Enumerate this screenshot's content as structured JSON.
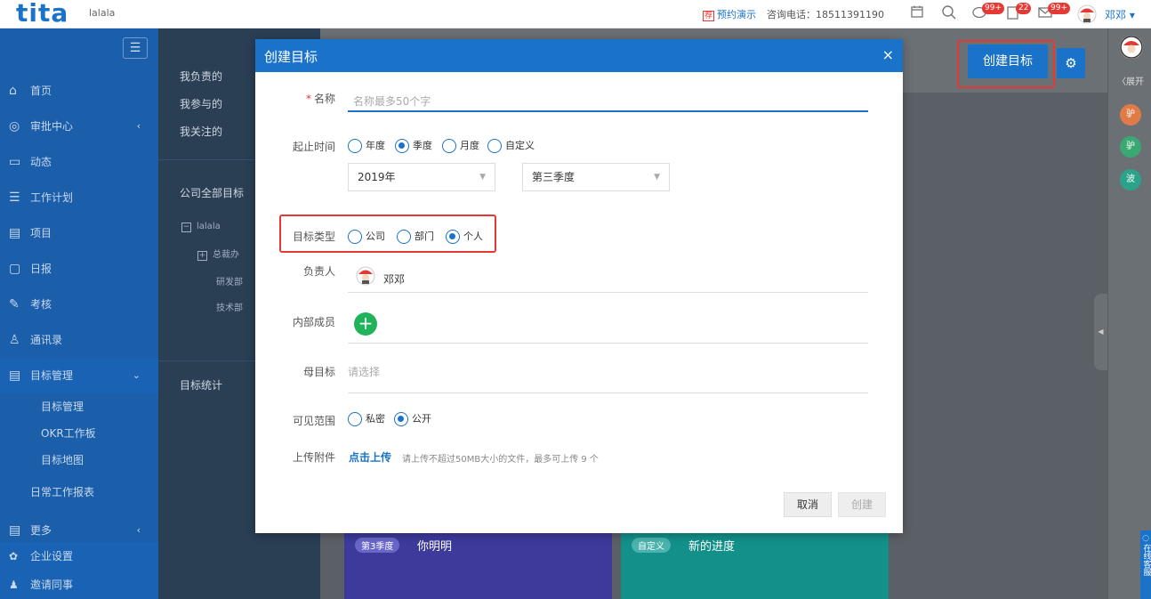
{
  "topbar": {
    "logo": "tita",
    "org": "lalala",
    "promo_tag": "荐",
    "promo_text": "预约演示",
    "phone": "咨询电话：18511391190",
    "badges": [
      "99+",
      "22",
      "99+"
    ],
    "user": "邓邓 ▾"
  },
  "sidebar": {
    "items": [
      {
        "icon": "⌂",
        "label": "首页"
      },
      {
        "icon": "◎",
        "label": "审批中心",
        "arrow": "‹"
      },
      {
        "icon": "▭",
        "label": "动态"
      },
      {
        "icon": "☰",
        "label": "工作计划"
      },
      {
        "icon": "▤",
        "label": "项目"
      },
      {
        "icon": "▢",
        "label": "日报"
      },
      {
        "icon": "✎",
        "label": "考核"
      },
      {
        "icon": "♙",
        "label": "通讯录"
      },
      {
        "icon": "▤",
        "label": "目标管理",
        "arrow": "⌄"
      }
    ],
    "sub_items": [
      "目标管理",
      "OKR工作板",
      "目标地图",
      "日常工作报表"
    ],
    "more": {
      "icon": "▤",
      "label": "更多",
      "arrow": "‹"
    },
    "bottom": [
      {
        "icon": "✿",
        "label": "企业设置"
      },
      {
        "icon": "♟",
        "label": "邀请同事"
      }
    ]
  },
  "panel2": {
    "items": [
      "我负责的",
      "我参与的",
      "我关注的"
    ],
    "section": "公司全部目标",
    "tree": [
      "lalala",
      "总裁办",
      "研发部",
      "技术部"
    ],
    "stats": "目标统计"
  },
  "main": {
    "create_btn": "创建目标",
    "cards": [
      {
        "tag": "第3季度",
        "title": "你明明"
      },
      {
        "tag": "自定义",
        "title": "新的进度"
      }
    ]
  },
  "rail": {
    "expand": "〈展开",
    "dots": [
      "驴",
      "驴",
      "波"
    ],
    "online": "在线客服"
  },
  "modal": {
    "title": "创建目标",
    "close": "×",
    "name_label": "名称",
    "name_placeholder": "名称最多50个字",
    "time_label": "起止时间",
    "time_options": [
      "年度",
      "季度",
      "月度",
      "自定义"
    ],
    "year_value": "2019年",
    "quarter_value": "第三季度",
    "type_label": "目标类型",
    "type_options": [
      "公司",
      "部门",
      "个人"
    ],
    "owner_label": "负责人",
    "owner_name": "邓邓",
    "members_label": "内部成员",
    "parent_label": "母目标",
    "parent_placeholder": "请选择",
    "visibility_label": "可见范围",
    "visibility_options": [
      "私密",
      "公开"
    ],
    "upload_label": "上传附件",
    "upload_link": "点击上传",
    "upload_hint": "请上传不超过50MB大小的文件，最多可上传 9 个",
    "cancel": "取消",
    "create": "创建"
  }
}
